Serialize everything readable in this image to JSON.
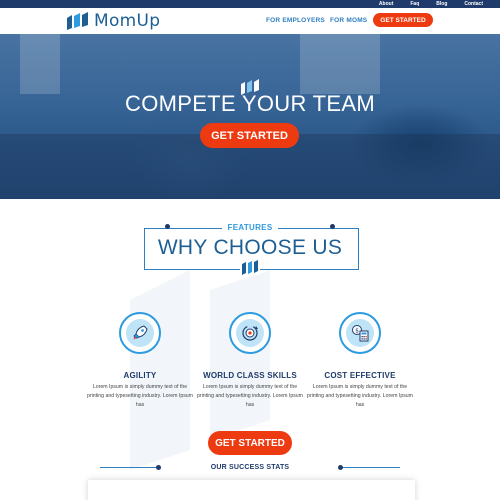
{
  "utility_nav": {
    "links": [
      "About",
      "Faq",
      "Blog",
      "Contact"
    ]
  },
  "header": {
    "logo_text": "MomUp",
    "links": [
      "FOR EMPLOYERS",
      "FOR MOMS"
    ],
    "cta_label": "GET STARTED"
  },
  "hero": {
    "title": "COMPETE YOUR TEAM",
    "cta_label": "GET STARTED"
  },
  "features": {
    "label": "FEATURES",
    "title": "WHY CHOOSE US",
    "items": [
      {
        "icon": "rocket-icon",
        "title": "AGILITY",
        "description": "Lorem Ipsum is simply dummy text of the printing and typesetting industry. Lorem Ipsum has"
      },
      {
        "icon": "cycle-target-icon",
        "title": "WORLD CLASS SKILLS",
        "description": "Lorem Ipsum is simply dummy text of the printing and typesetting industry. Lorem Ipsum has"
      },
      {
        "icon": "calculator-dollar-icon",
        "title": "COST EFFECTIVE",
        "description": "Lorem Ipsum is simply dummy text of the printing and typesetting industry. Lorem Ipsum has"
      }
    ],
    "cta_label": "GET STARTED"
  },
  "stats": {
    "title": "OUR SUCCESS STATS"
  },
  "colors": {
    "navy": "#1f3b6b",
    "brand_blue": "#1d5f94",
    "accent_blue": "#2d9be0",
    "cta_red": "#ee3a10"
  }
}
